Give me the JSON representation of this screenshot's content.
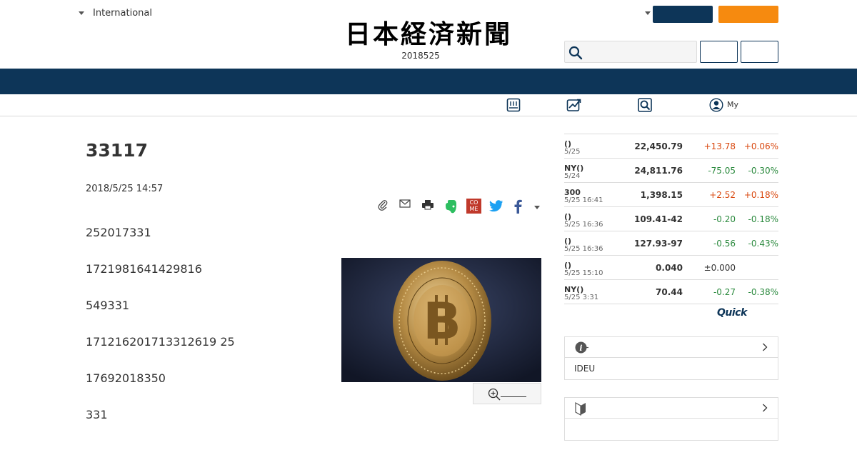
{
  "header": {
    "edition_label": "International",
    "logo_text": "日本経済新聞",
    "logo_date": "2018525",
    "search_placeholder": ""
  },
  "subnav": {
    "my_label": "My"
  },
  "article": {
    "title": "33117",
    "date": "2018/5/25 14:57",
    "paragraphs": [
      "252017331",
      "1721981641429816",
      "549331",
      "171216201713312619 25",
      "17692018350",
      "331"
    ]
  },
  "market": {
    "rows": [
      {
        "name": "()",
        "time": "5/25",
        "value": "22,450.79",
        "change": "+13.78",
        "pct": "+0.06%",
        "dir": "up"
      },
      {
        "name": "NY()",
        "time": "5/24",
        "value": "24,811.76",
        "change": "-75.05",
        "pct": "-0.30%",
        "dir": "down"
      },
      {
        "name": "300",
        "time": "5/25 16:41",
        "value": "1,398.15",
        "change": "+2.52",
        "pct": "+0.18%",
        "dir": "up"
      },
      {
        "name": "()",
        "time": "5/25 16:36",
        "value": "109.41-42",
        "change": "-0.20",
        "pct": "-0.18%",
        "dir": "down"
      },
      {
        "name": "()",
        "time": "5/25 16:36",
        "value": "127.93-97",
        "change": "-0.56",
        "pct": "-0.43%",
        "dir": "down"
      },
      {
        "name": "()",
        "time": "5/25 15:10",
        "value": "0.040",
        "change": "±0.000",
        "pct": "",
        "dir": "flat"
      },
      {
        "name": "NY()",
        "time": "5/25 3:31",
        "value": "70.44",
        "change": "-0.27",
        "pct": "-0.38%",
        "dir": "down"
      }
    ],
    "source_logo": "Quick"
  },
  "side_boxes": [
    {
      "text": "IDEU"
    },
    {
      "text": ""
    }
  ],
  "colors": {
    "navy": "#0d3558",
    "orange": "#f68a0f",
    "up": "#d9480f",
    "down": "#2b8a3e"
  }
}
